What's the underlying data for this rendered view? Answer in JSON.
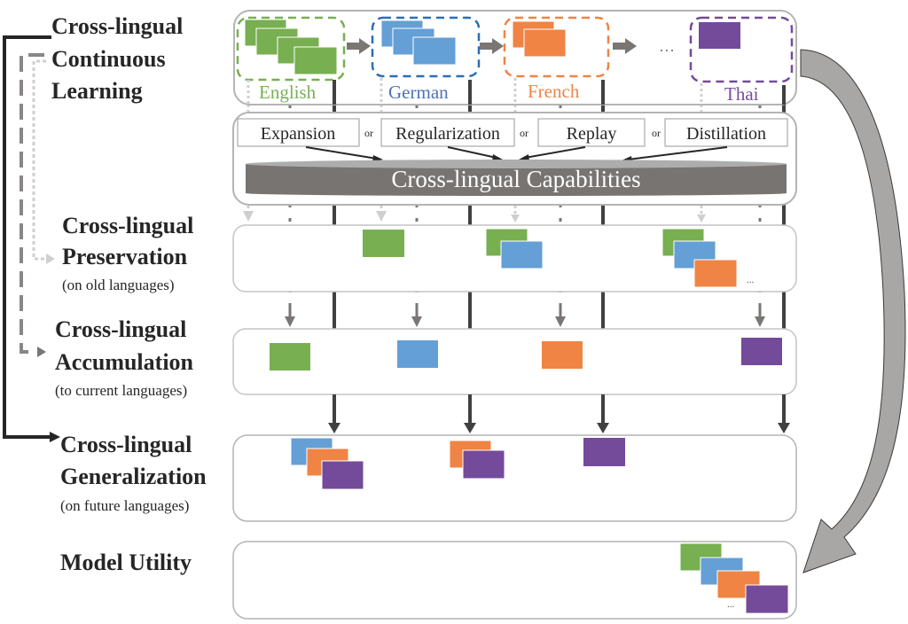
{
  "colors": {
    "english": "#78AF51",
    "german": "#649FD6",
    "french": "#EF8444",
    "thai": "#744A9A",
    "english_text": "#77B055",
    "german_text": "#4E73B8",
    "french_text": "#EE8648",
    "thai_text": "#7A4A9C",
    "dark_line": "#404040",
    "gray_arrow": "#7A7674",
    "light_arrow": "#CFCFCF",
    "cylinder": "#787472",
    "cylinder_top": "#ADADAD",
    "panel_border": "#B4B4B4",
    "big_arrow": "#A9A7A6"
  },
  "left_labels": {
    "continuous": {
      "line1": "Cross-lingual",
      "line2": "Continuous",
      "line3": "Learning"
    },
    "preservation": {
      "line1": "Cross-lingual",
      "line2": "Preservation",
      "note": "(on old languages)"
    },
    "accumulation": {
      "line1": "Cross-lingual",
      "line2": "Accumulation",
      "note": "(to current languages)"
    },
    "generalization": {
      "line1": "Cross-lingual",
      "line2": "Generalization",
      "note": "(on future languages)"
    },
    "utility": {
      "line1": "Model Utility"
    }
  },
  "languages": [
    {
      "name": "English",
      "key": "english",
      "docs": 4
    },
    {
      "name": "German",
      "key": "german",
      "docs": 3
    },
    {
      "name": "French",
      "key": "french",
      "docs": 2
    },
    {
      "name": "Thai",
      "key": "thai",
      "docs": 1
    }
  ],
  "ellipsis": "…",
  "small_ellipsis": "...",
  "methods": {
    "items": [
      "Expansion",
      "Regularization",
      "Replay",
      "Distillation"
    ],
    "connector": "or"
  },
  "capabilities_label": "Cross-lingual Capabilities"
}
